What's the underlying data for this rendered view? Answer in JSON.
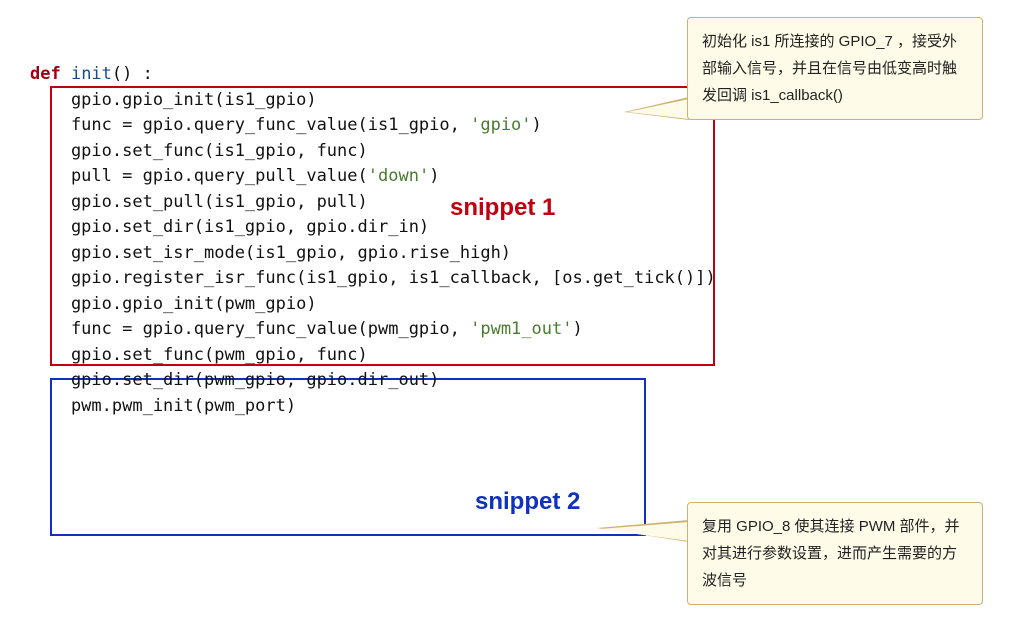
{
  "code": {
    "def_kw": "def",
    "fn_name": " init",
    "fn_paren": "() :",
    "l1": "    gpio.gpio_init(is1_gpio)",
    "blank": "",
    "l2a": "    func = gpio.query_func_value(is1_gpio, ",
    "l2s": "'gpio'",
    "l2b": ")",
    "l3": "    gpio.set_func(is1_gpio, func)",
    "l4a": "    pull = gpio.query_pull_value(",
    "l4s": "'down'",
    "l4b": ")",
    "l5": "    gpio.set_pull(is1_gpio, pull)",
    "l6": "    gpio.set_dir(is1_gpio, gpio.dir_in)",
    "l7": "    gpio.set_isr_mode(is1_gpio, gpio.rise_high)",
    "l8": "    gpio.register_isr_func(is1_gpio, is1_callback, [os.get_tick()])",
    "l9": "    gpio.gpio_init(pwm_gpio)",
    "l10a": "    func = gpio.query_func_value(pwm_gpio, ",
    "l10s": "'pwm1_out'",
    "l10b": ")",
    "l11": "    gpio.set_func(pwm_gpio, func)",
    "l12": "    gpio.set_dir(pwm_gpio, gpio.dir_out)",
    "l13": "    pwm.pwm_init(pwm_port)"
  },
  "labels": {
    "snippet1": "snippet 1",
    "snippet2": "snippet 2"
  },
  "callouts": {
    "c1": "初始化 is1 所连接的 GPIO_7 ，接受外部输入信号，并且在信号由低变高时触发回调 is1_callback()",
    "c2": "复用 GPIO_8 使其连接 PWM 部件，并对其进行参数设置，进而产生需要的方波信号"
  }
}
